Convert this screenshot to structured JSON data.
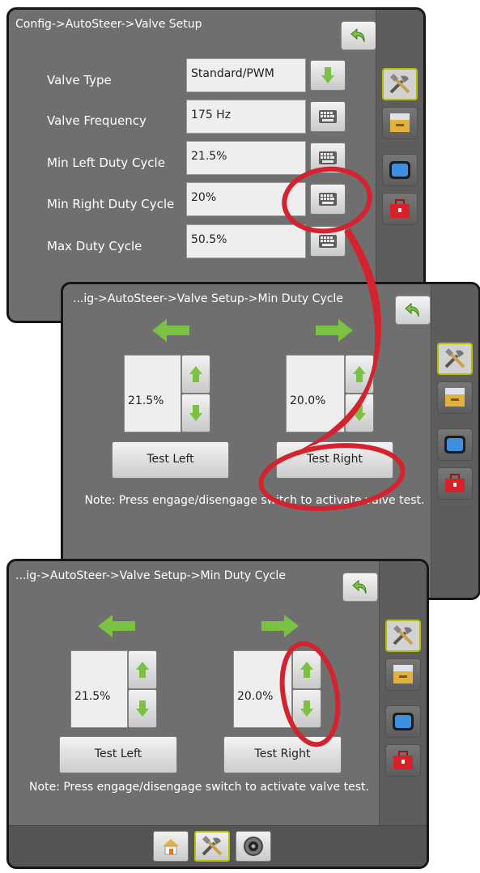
{
  "valve_setup": {
    "breadcrumb": "Config->AutoSteer->Valve Setup",
    "rows": [
      {
        "label": "Valve Type",
        "value": "Standard/PWM",
        "control": "down-arrow"
      },
      {
        "label": "Valve Frequency",
        "value": "175 Hz",
        "control": "keyboard"
      },
      {
        "label": "Min Left Duty Cycle",
        "value": "21.5%",
        "control": "keyboard"
      },
      {
        "label": "Min Right Duty Cycle",
        "value": "20%",
        "control": "keyboard"
      },
      {
        "label": "Max Duty Cycle",
        "value": "50.5%",
        "control": "keyboard"
      }
    ]
  },
  "min_duty_1": {
    "breadcrumb": "...ig->AutoSteer->Valve Setup->Min Duty Cycle",
    "left_value": "21.5%",
    "right_value": "20.0%",
    "test_left": "Test Left",
    "test_right": "Test Right",
    "note": "Note: Press engage/disengage switch to activate valve test."
  },
  "min_duty_2": {
    "breadcrumb": "...ig->AutoSteer->Valve Setup->Min Duty Cycle",
    "left_value": "21.5%",
    "right_value": "20.0%",
    "test_left": "Test Left",
    "test_right": "Test Right",
    "note": "Note: Press engage/disengage switch to activate valve test."
  },
  "sidebar_icons": [
    "tools-icon",
    "console-icon",
    "monitor-icon",
    "toolbox-icon"
  ],
  "bottom_tabs": [
    "home-icon",
    "tools-icon",
    "camera-icon"
  ],
  "colors": {
    "panel": "#6f6f6f",
    "highlight": "#b4c000",
    "arrow_green": "#7cc242",
    "annotation_red": "#d4232f"
  }
}
